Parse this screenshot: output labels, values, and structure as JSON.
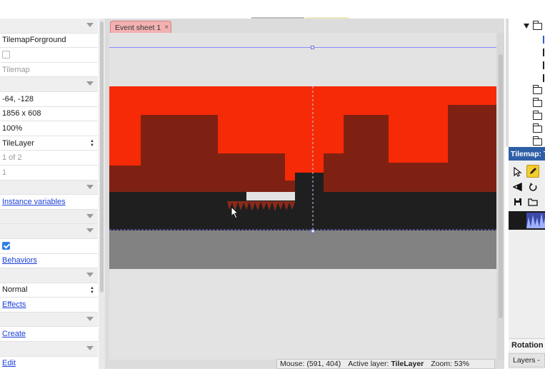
{
  "props": {
    "rows": [
      {
        "kind": "category"
      },
      {
        "kind": "text",
        "value": "TilemapForground"
      },
      {
        "kind": "checkbox",
        "checked": false
      },
      {
        "kind": "text",
        "value": "Tilemap",
        "muted": true
      },
      {
        "kind": "category"
      },
      {
        "kind": "text",
        "value": "-64, -128"
      },
      {
        "kind": "text",
        "value": "1856 x 608"
      },
      {
        "kind": "text",
        "value": "100%"
      },
      {
        "kind": "select",
        "value": "TileLayer"
      },
      {
        "kind": "text",
        "value": "1 of 2",
        "muted": true
      },
      {
        "kind": "text",
        "value": "1",
        "muted": true
      },
      {
        "kind": "category"
      },
      {
        "kind": "link",
        "value": "Instance variables"
      },
      {
        "kind": "category"
      },
      {
        "kind": "category"
      },
      {
        "kind": "checkbox",
        "checked": true
      },
      {
        "kind": "link",
        "value": "Behaviors"
      },
      {
        "kind": "category"
      },
      {
        "kind": "select",
        "value": "Normal"
      },
      {
        "kind": "link",
        "value": "Effects"
      },
      {
        "kind": "category"
      },
      {
        "kind": "link",
        "value": "Create"
      },
      {
        "kind": "category"
      },
      {
        "kind": "link",
        "value": "Edit"
      }
    ]
  },
  "editor": {
    "tab_label": "Event sheet 1",
    "tab_close": "×",
    "status": {
      "mouse": "Mouse: (591, 404)",
      "active_layer_label": "Active layer:",
      "active_layer_value": "TileLayer",
      "zoom": "Zoom: 53%"
    },
    "colors": {
      "sky": "#f62a06",
      "mountain": "#7e2113",
      "ground": "#1f1f1f",
      "below": "#828282",
      "spikes": "#8a2a1b"
    }
  },
  "right": {
    "tilemap_title": "Tilemap: T",
    "rotation_label": "Rotation",
    "layers_tab": "Layers -",
    "tools": [
      "cursor-icon",
      "pencil-icon",
      "eraser-icon",
      "rotate-icon",
      "save-icon",
      "folder-icon"
    ]
  }
}
